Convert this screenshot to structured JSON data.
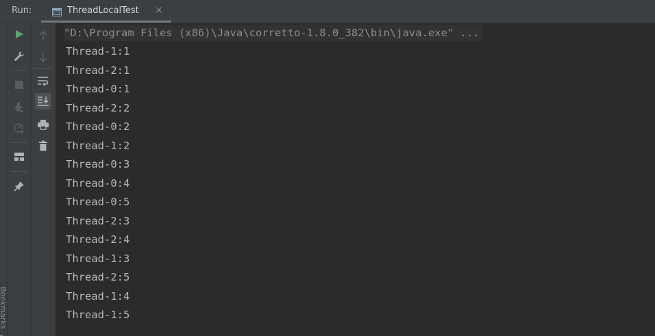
{
  "header": {
    "run_label": "Run:",
    "tab": {
      "title": "ThreadLocalTest",
      "close_glyph": "×",
      "icon": "console-window-icon"
    }
  },
  "side_strip": {
    "label": "Bookmarks"
  },
  "toolbar_left": [
    {
      "icon": "play-icon",
      "color": "#59a869"
    },
    {
      "icon": "wrench-icon"
    },
    {
      "icon": "stop-icon",
      "disabled": true
    },
    {
      "icon": "debug-bug-icon",
      "disabled": true
    },
    {
      "icon": "profiler-icon",
      "disabled": true
    },
    {
      "icon": "layout-icon"
    },
    {
      "icon": "pin-icon"
    }
  ],
  "toolbar_right": [
    {
      "icon": "arrow-up-icon",
      "disabled": true
    },
    {
      "icon": "arrow-down-icon",
      "disabled": true
    },
    {
      "icon": "soft-wrap-icon"
    },
    {
      "icon": "scroll-to-end-icon",
      "active": true
    },
    {
      "icon": "print-icon"
    },
    {
      "icon": "trash-icon"
    }
  ],
  "console": {
    "command": "\"D:\\Program Files (x86)\\Java\\corretto-1.8.0_382\\bin\\java.exe\" ...",
    "lines": [
      "Thread-1:1",
      "Thread-2:1",
      "Thread-0:1",
      "Thread-2:2",
      "Thread-0:2",
      "Thread-1:2",
      "Thread-0:3",
      "Thread-0:4",
      "Thread-0:5",
      "Thread-2:3",
      "Thread-2:4",
      "Thread-1:3",
      "Thread-2:5",
      "Thread-1:4",
      "Thread-1:5"
    ]
  },
  "colors": {
    "background": "#2b2b2b",
    "panel": "#3c3f41",
    "output_text": "#bababa",
    "command_text": "#8c8c8c",
    "run_green": "#59a869"
  }
}
